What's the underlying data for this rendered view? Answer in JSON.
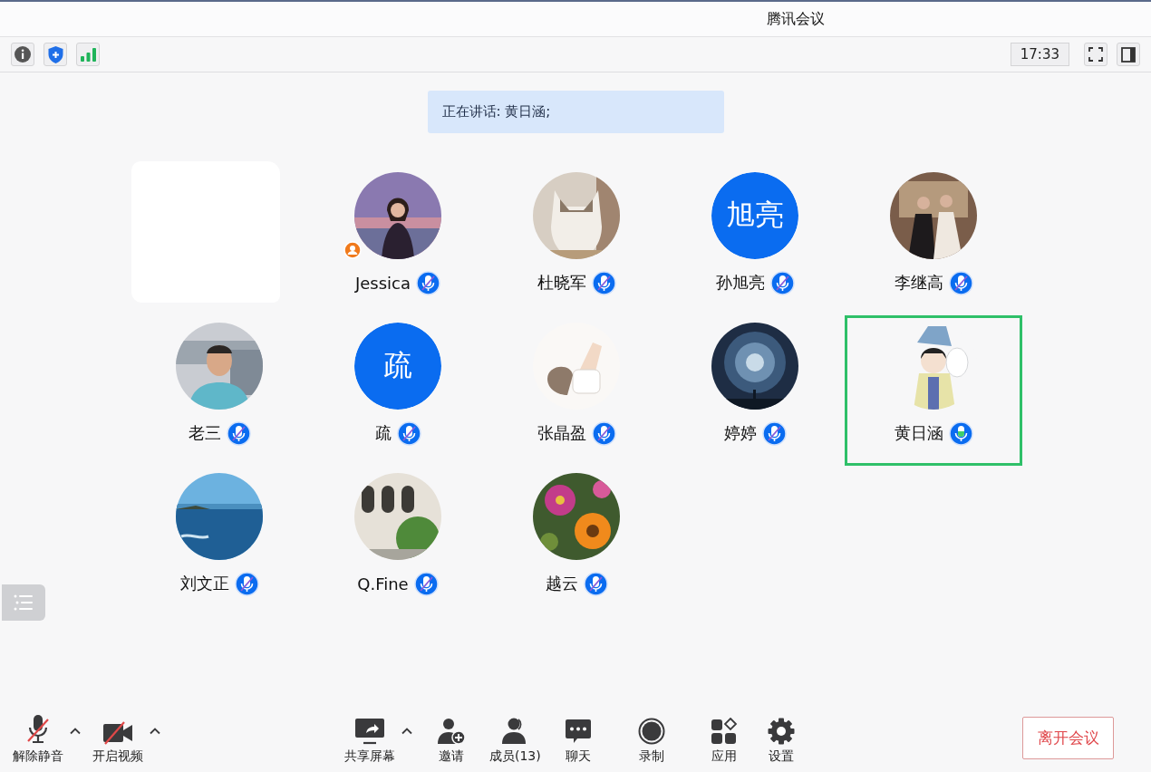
{
  "window": {
    "title": "腾讯会议"
  },
  "status_bar": {
    "time": "17:33"
  },
  "speaking_banner": {
    "text": "正在讲话: 黄日涵;"
  },
  "participants": [
    {
      "kind": "blank"
    },
    {
      "name": "Jessica",
      "host": true,
      "muted": true,
      "speaking": false
    },
    {
      "name": "杜晓军",
      "host": false,
      "muted": true,
      "speaking": false
    },
    {
      "kind": "initials",
      "initials": "旭亮",
      "name": "孙旭亮",
      "host": false,
      "muted": true,
      "speaking": false
    },
    {
      "name": "李继高",
      "host": false,
      "muted": true,
      "speaking": false
    },
    {
      "name": "老三",
      "host": false,
      "muted": true,
      "speaking": false
    },
    {
      "kind": "initials",
      "initials": "疏",
      "name": "疏",
      "host": false,
      "muted": true,
      "speaking": false
    },
    {
      "name": "张晶盈",
      "host": false,
      "muted": true,
      "speaking": false
    },
    {
      "name": "婷婷",
      "host": false,
      "muted": true,
      "speaking": false
    },
    {
      "name": "黄日涵",
      "host": false,
      "muted": false,
      "speaking": true
    },
    {
      "name": "刘文正",
      "host": false,
      "muted": true,
      "speaking": false
    },
    {
      "name": "Q.Fine",
      "host": false,
      "muted": true,
      "speaking": false
    },
    {
      "name": "越云",
      "host": false,
      "muted": true,
      "speaking": false
    }
  ],
  "left_controls": [
    {
      "kind": "mic-off",
      "label": "解除静音",
      "menu": true
    },
    {
      "kind": "video-off",
      "label": "开启视频",
      "menu": true
    }
  ],
  "center_controls": [
    {
      "kind": "share",
      "label": "共享屏幕",
      "menu": true
    },
    {
      "kind": "invite",
      "label": "邀请",
      "menu": false
    },
    {
      "kind": "members",
      "label": "成员(13)",
      "menu": false
    },
    {
      "kind": "chat",
      "label": "聊天",
      "menu": false
    },
    {
      "kind": "record",
      "label": "录制",
      "menu": false
    },
    {
      "kind": "apps",
      "label": "应用",
      "menu": false
    },
    {
      "kind": "settings",
      "label": "设置",
      "menu": false
    }
  ],
  "leave_button": {
    "label": "离开会议"
  }
}
